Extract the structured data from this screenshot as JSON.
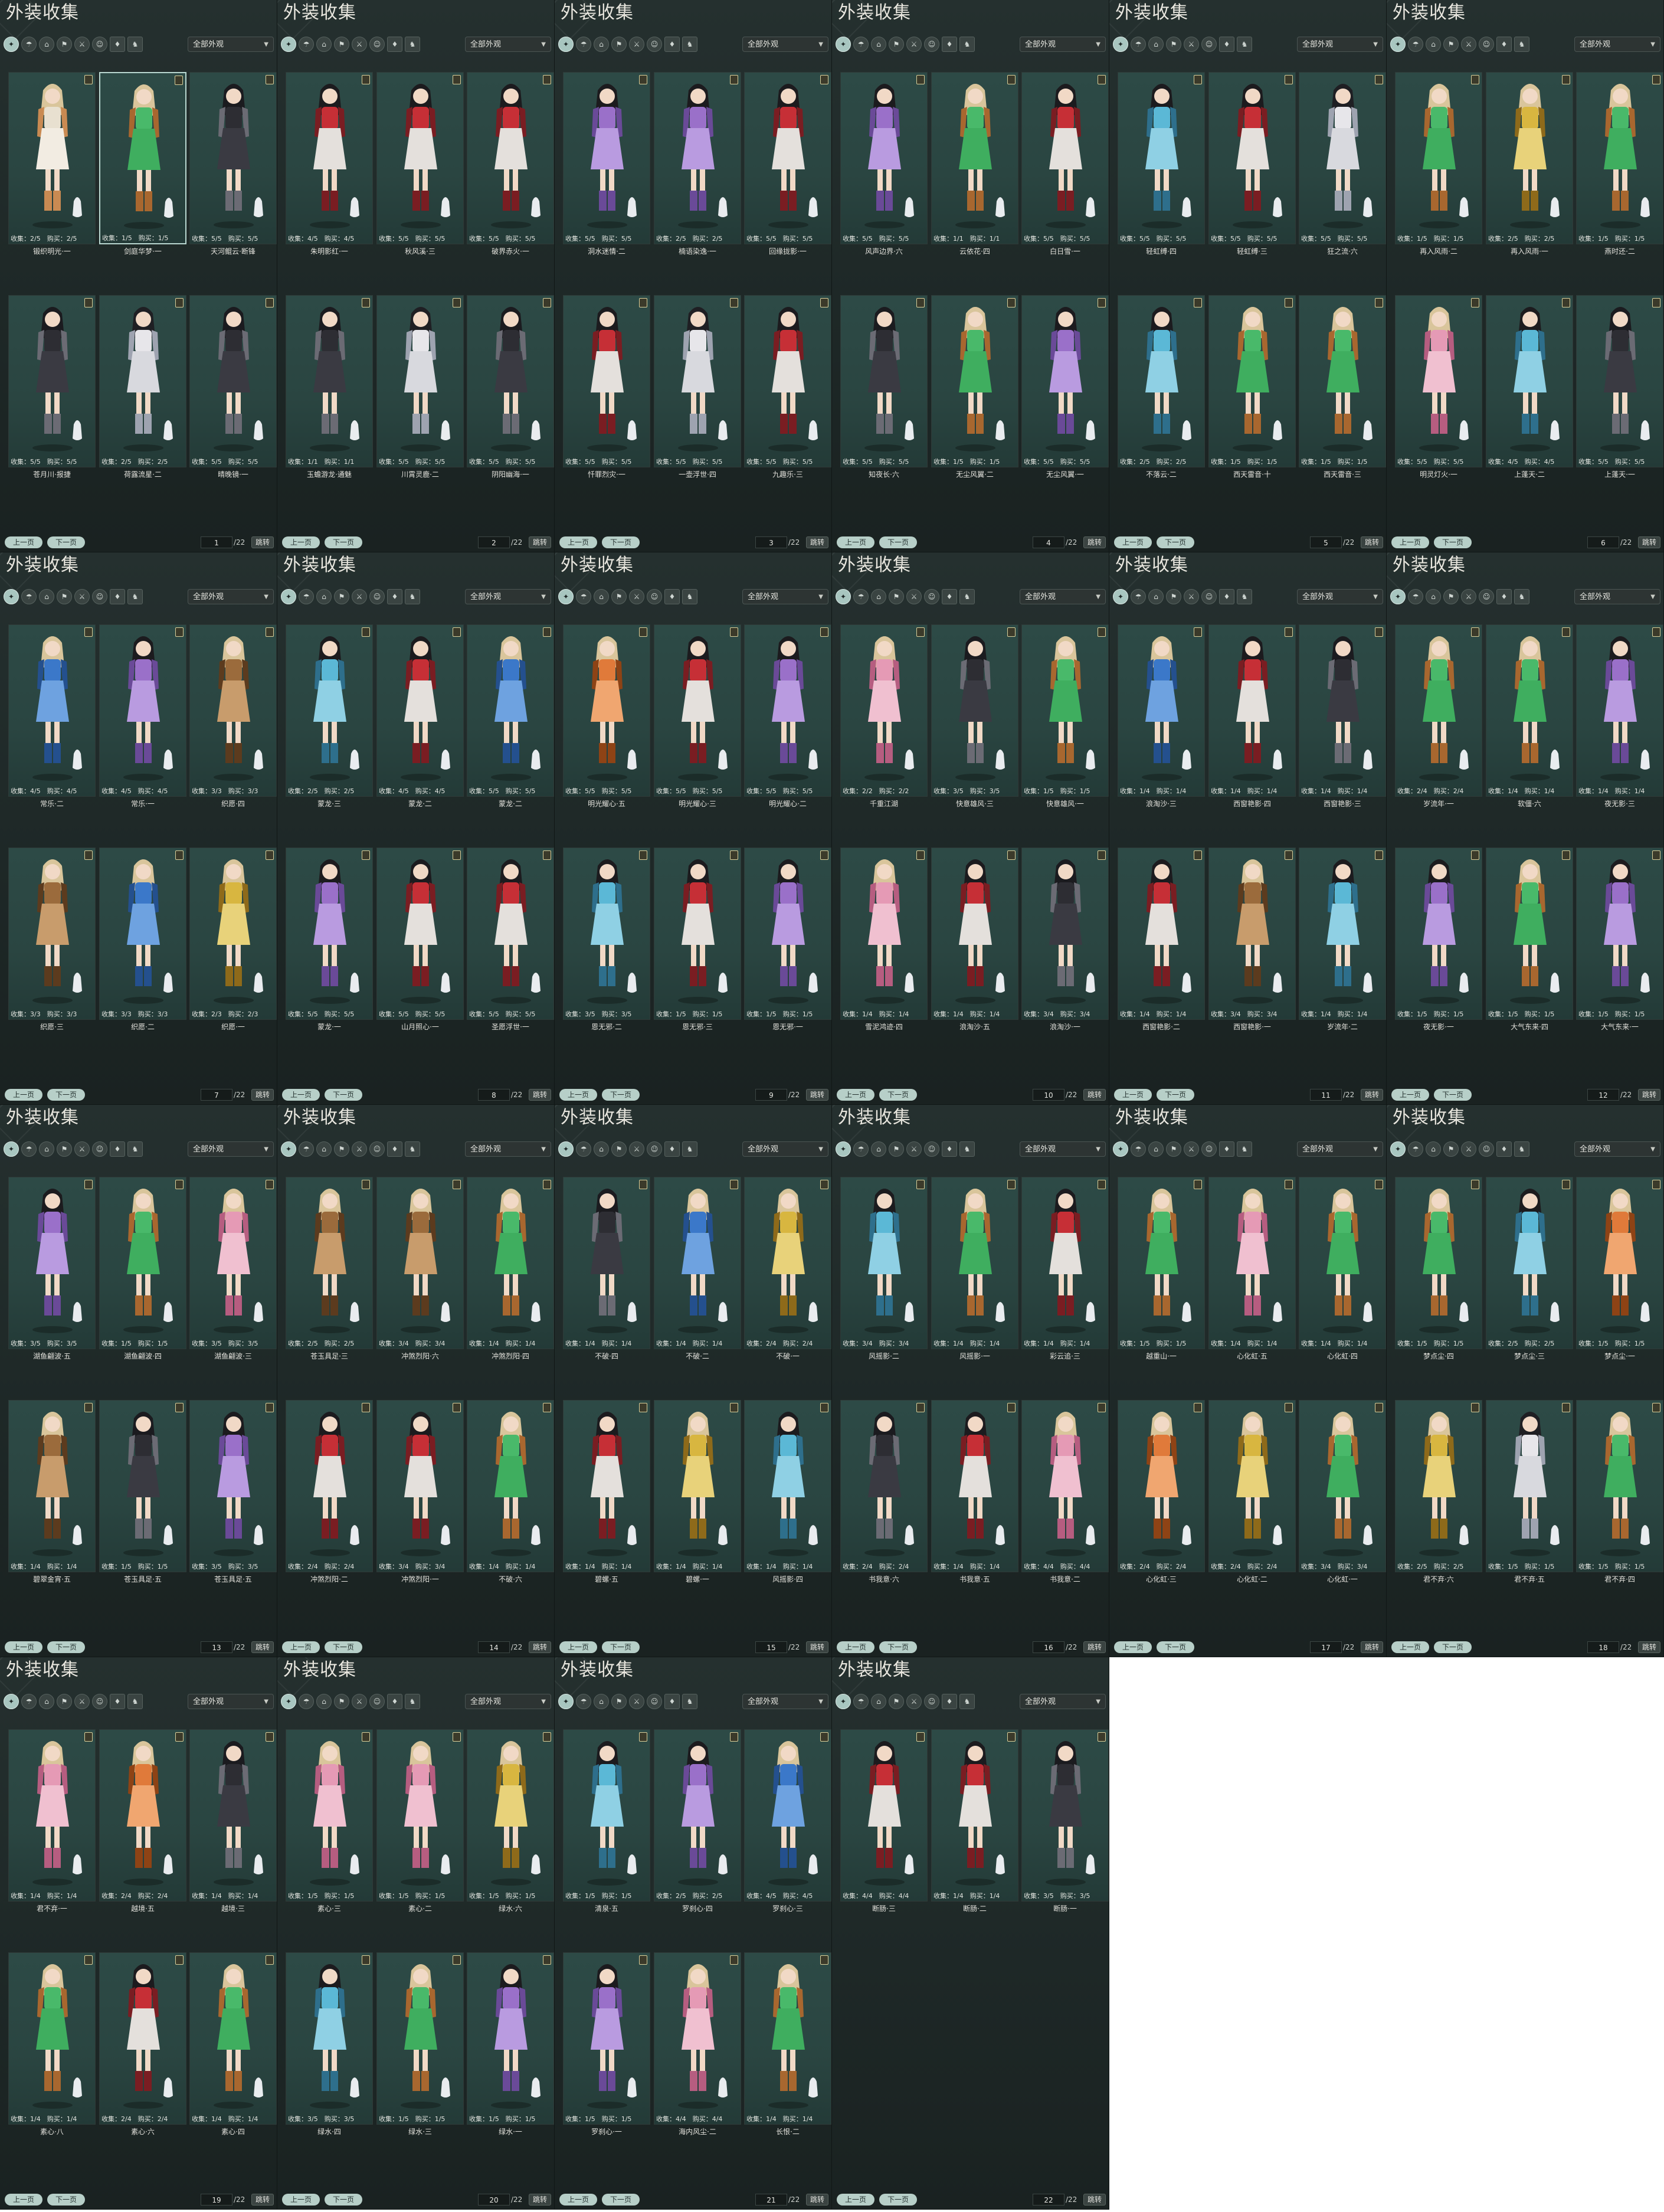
{
  "common": {
    "panel_title": "外装收集",
    "filter_value": "全部外观",
    "prev_label": "上一页",
    "next_label": "下一页",
    "jump_label": "跳转",
    "total_label": "/22",
    "tab_icons": [
      "outfit-tab",
      "hair-tab",
      "hat-tab",
      "back-tab",
      "weapon-tab",
      "face-tab",
      "pendant-tab",
      "mount-tab"
    ]
  },
  "colors": {
    "panel_bg": "#1e2827",
    "card_bg": "#2a4541",
    "accent_button": "#b7cfc8",
    "text": "#e3e2dc"
  },
  "pages": [
    {
      "page": "1",
      "items": [
        {
          "name": "锻织明光·一",
          "collect": "2/5",
          "buy": "2/5",
          "style": "a"
        },
        {
          "name": "剑庭华梦·一",
          "collect": "1/5",
          "buy": "1/5",
          "style": "b",
          "selected": true
        },
        {
          "name": "天河鲲云·断锋",
          "collect": "5/5",
          "buy": "5/5",
          "style": "k"
        },
        {
          "name": "苍月川·报捷",
          "collect": "5/5",
          "buy": "5/5",
          "style": "k"
        },
        {
          "name": "荷露流星·二",
          "collect": "2/5",
          "buy": "2/5",
          "style": "w"
        },
        {
          "name": "晴晚镜·一",
          "collect": "5/5",
          "buy": "5/5",
          "style": "k"
        }
      ]
    },
    {
      "page": "2",
      "items": [
        {
          "name": "朱明影红·一",
          "collect": "4/5",
          "buy": "4/5",
          "style": "r"
        },
        {
          "name": "秋风溪·三",
          "collect": "5/5",
          "buy": "5/5",
          "style": "r"
        },
        {
          "name": "破界赤火·一",
          "collect": "5/5",
          "buy": "5/5",
          "style": "r"
        },
        {
          "name": "玉蟾游龙·通魅",
          "collect": "1/1",
          "buy": "1/1",
          "style": "k"
        },
        {
          "name": "川霄灵鹿·二",
          "collect": "5/5",
          "buy": "5/5",
          "style": "w"
        },
        {
          "name": "阴阳幽海·一",
          "collect": "5/5",
          "buy": "5/5",
          "style": "k"
        }
      ]
    },
    {
      "page": "3",
      "items": [
        {
          "name": "洞水迷情·二",
          "collect": "5/5",
          "buy": "5/5",
          "style": "p"
        },
        {
          "name": "楠语染逸·一",
          "collect": "2/5",
          "buy": "2/5",
          "style": "p"
        },
        {
          "name": "回缘拢影·一",
          "collect": "5/5",
          "buy": "5/5",
          "style": "r"
        },
        {
          "name": "忏罪烈灾·一",
          "collect": "5/5",
          "buy": "5/5",
          "style": "r"
        },
        {
          "name": "一壶浮世·四",
          "collect": "5/5",
          "buy": "5/5",
          "style": "w"
        },
        {
          "name": "九趣乐·三",
          "collect": "5/5",
          "buy": "5/5",
          "style": "r"
        }
      ]
    },
    {
      "page": "4",
      "items": [
        {
          "name": "风声边界·六",
          "collect": "5/5",
          "buy": "5/5",
          "style": "p"
        },
        {
          "name": "云依花·四",
          "collect": "1/1",
          "buy": "1/1",
          "style": "g"
        },
        {
          "name": "白日雪·一",
          "collect": "5/5",
          "buy": "5/5",
          "style": "r"
        },
        {
          "name": "知夜长·六",
          "collect": "5/5",
          "buy": "5/5",
          "style": "k"
        },
        {
          "name": "无尘风翼·二",
          "collect": "1/5",
          "buy": "1/5",
          "style": "g"
        },
        {
          "name": "无尘风翼·一",
          "collect": "5/5",
          "buy": "5/5",
          "style": "p"
        }
      ]
    },
    {
      "page": "5",
      "items": [
        {
          "name": "轻虹缚·四",
          "collect": "5/5",
          "buy": "5/5",
          "style": "c"
        },
        {
          "name": "轻虹缚·三",
          "collect": "5/5",
          "buy": "5/5",
          "style": "r"
        },
        {
          "name": "狂之流·六",
          "collect": "5/5",
          "buy": "5/5",
          "style": "w"
        },
        {
          "name": "不落云·二",
          "collect": "2/5",
          "buy": "2/5",
          "style": "c"
        },
        {
          "name": "西天雷音·十",
          "collect": "1/5",
          "buy": "1/5",
          "style": "g"
        },
        {
          "name": "西天雷音·三",
          "collect": "1/5",
          "buy": "1/5",
          "style": "g"
        }
      ]
    },
    {
      "page": "6",
      "items": [
        {
          "name": "再入风雨·二",
          "collect": "1/5",
          "buy": "1/5",
          "style": "g"
        },
        {
          "name": "再入风雨·一",
          "collect": "2/5",
          "buy": "2/5",
          "style": "y"
        },
        {
          "name": "燕时还·二",
          "collect": "1/5",
          "buy": "1/5",
          "style": "g"
        },
        {
          "name": "明灵灯火·一",
          "collect": "5/5",
          "buy": "5/5",
          "style": "pk"
        },
        {
          "name": "上蓬天·二",
          "collect": "4/5",
          "buy": "4/5",
          "style": "c"
        },
        {
          "name": "上蓬天·一",
          "collect": "5/5",
          "buy": "5/5",
          "style": "k"
        }
      ]
    },
    {
      "page": "7",
      "items": [
        {
          "name": "常乐·二",
          "collect": "4/5",
          "buy": "4/5",
          "style": "bl"
        },
        {
          "name": "常乐·一",
          "collect": "4/5",
          "buy": "4/5",
          "style": "p"
        },
        {
          "name": "织愿·四",
          "collect": "3/3",
          "buy": "3/3",
          "style": "br"
        },
        {
          "name": "织愿·三",
          "collect": "3/3",
          "buy": "3/3",
          "style": "br"
        },
        {
          "name": "织愿·二",
          "collect": "3/3",
          "buy": "3/3",
          "style": "bl"
        },
        {
          "name": "织愿·一",
          "collect": "2/3",
          "buy": "2/3",
          "style": "y"
        }
      ]
    },
    {
      "page": "8",
      "items": [
        {
          "name": "蒙龙·三",
          "collect": "2/5",
          "buy": "2/5",
          "style": "c"
        },
        {
          "name": "蒙龙·二",
          "collect": "4/5",
          "buy": "4/5",
          "style": "r"
        },
        {
          "name": "蒙龙·二",
          "collect": "5/5",
          "buy": "5/5",
          "style": "bl"
        },
        {
          "name": "蒙龙·一",
          "collect": "5/5",
          "buy": "5/5",
          "style": "p"
        },
        {
          "name": "山月照心·一",
          "collect": "5/5",
          "buy": "5/5",
          "style": "r"
        },
        {
          "name": "圣愿浮世·一",
          "collect": "5/5",
          "buy": "5/5",
          "style": "r"
        }
      ]
    },
    {
      "page": "9",
      "items": [
        {
          "name": "明光耀心·五",
          "collect": "5/5",
          "buy": "5/5",
          "style": "o"
        },
        {
          "name": "明光耀心·三",
          "collect": "5/5",
          "buy": "5/5",
          "style": "r"
        },
        {
          "name": "明光耀心·二",
          "collect": "5/5",
          "buy": "5/5",
          "style": "p"
        },
        {
          "name": "恩无邪·二",
          "collect": "3/5",
          "buy": "3/5",
          "style": "c"
        },
        {
          "name": "恩无邪·三",
          "collect": "1/5",
          "buy": "1/5",
          "style": "r"
        },
        {
          "name": "恩无邪·一",
          "collect": "1/5",
          "buy": "1/5",
          "style": "p"
        }
      ]
    },
    {
      "page": "10",
      "items": [
        {
          "name": "千重江湖",
          "collect": "2/2",
          "buy": "2/2",
          "style": "pk"
        },
        {
          "name": "快意雄风·三",
          "collect": "3/5",
          "buy": "3/5",
          "style": "k"
        },
        {
          "name": "快意雄风·一",
          "collect": "1/5",
          "buy": "1/5",
          "style": "g"
        },
        {
          "name": "雪泥鸿迹·四",
          "collect": "1/4",
          "buy": "1/4",
          "style": "pk"
        },
        {
          "name": "浪淘沙·五",
          "collect": "1/4",
          "buy": "1/4",
          "style": "r"
        },
        {
          "name": "浪淘沙·一",
          "collect": "3/4",
          "buy": "3/4",
          "style": "k"
        }
      ]
    },
    {
      "page": "11",
      "items": [
        {
          "name": "浪淘沙·三",
          "collect": "1/4",
          "buy": "1/4",
          "style": "bl"
        },
        {
          "name": "西窗艳影·四",
          "collect": "1/4",
          "buy": "1/4",
          "style": "r"
        },
        {
          "name": "西窗艳影·三",
          "collect": "1/4",
          "buy": "1/4",
          "style": "k"
        },
        {
          "name": "西窗艳影·二",
          "collect": "1/4",
          "buy": "1/4",
          "style": "r"
        },
        {
          "name": "西窗艳影·一",
          "collect": "3/4",
          "buy": "3/4",
          "style": "br"
        },
        {
          "name": "岁流年·二",
          "collect": "1/4",
          "buy": "1/4",
          "style": "c"
        }
      ]
    },
    {
      "page": "12",
      "items": [
        {
          "name": "岁流年·一",
          "collect": "2/4",
          "buy": "2/4",
          "style": "g"
        },
        {
          "name": "软僵·六",
          "collect": "1/4",
          "buy": "1/4",
          "style": "g"
        },
        {
          "name": "夜无影·三",
          "collect": "1/4",
          "buy": "1/4",
          "style": "p"
        },
        {
          "name": "夜无影·一",
          "collect": "1/5",
          "buy": "1/5",
          "style": "p"
        },
        {
          "name": "大气东来·四",
          "collect": "1/5",
          "buy": "1/5",
          "style": "g"
        },
        {
          "name": "大气东来·一",
          "collect": "1/5",
          "buy": "1/5",
          "style": "p"
        }
      ]
    },
    {
      "page": "13",
      "items": [
        {
          "name": "湖鱼翩波·五",
          "collect": "3/5",
          "buy": "3/5",
          "style": "p"
        },
        {
          "name": "湖鱼翩波·四",
          "collect": "1/5",
          "buy": "1/5",
          "style": "g"
        },
        {
          "name": "湖鱼翩波·三",
          "collect": "3/5",
          "buy": "3/5",
          "style": "pk"
        },
        {
          "name": "碧翠金宵·五",
          "collect": "1/4",
          "buy": "1/4",
          "style": "br"
        },
        {
          "name": "苍玉具足·五",
          "collect": "1/5",
          "buy": "1/5",
          "style": "k"
        },
        {
          "name": "苍玉具足·五",
          "collect": "3/5",
          "buy": "3/5",
          "style": "p"
        }
      ]
    },
    {
      "page": "14",
      "items": [
        {
          "name": "苍玉具足·三",
          "collect": "2/5",
          "buy": "2/5",
          "style": "br"
        },
        {
          "name": "冲煞烈阳·六",
          "collect": "3/4",
          "buy": "3/4",
          "style": "br"
        },
        {
          "name": "冲煞烈阳·四",
          "collect": "1/4",
          "buy": "1/4",
          "style": "g"
        },
        {
          "name": "冲煞烈阳·二",
          "collect": "2/4",
          "buy": "2/4",
          "style": "r"
        },
        {
          "name": "冲煞烈阳·一",
          "collect": "3/4",
          "buy": "3/4",
          "style": "r"
        },
        {
          "name": "不破·六",
          "collect": "1/4",
          "buy": "1/4",
          "style": "g"
        }
      ]
    },
    {
      "page": "15",
      "items": [
        {
          "name": "不破·四",
          "collect": "1/4",
          "buy": "1/4",
          "style": "k"
        },
        {
          "name": "不破·二",
          "collect": "1/4",
          "buy": "1/4",
          "style": "bl"
        },
        {
          "name": "不破·一",
          "collect": "2/4",
          "buy": "2/4",
          "style": "y"
        },
        {
          "name": "碧螺·五",
          "collect": "1/4",
          "buy": "1/4",
          "style": "r"
        },
        {
          "name": "碧螺·一",
          "collect": "1/4",
          "buy": "1/4",
          "style": "y"
        },
        {
          "name": "风摇影·四",
          "collect": "1/4",
          "buy": "1/4",
          "style": "c"
        }
      ]
    },
    {
      "page": "16",
      "items": [
        {
          "name": "风摇影·二",
          "collect": "3/4",
          "buy": "3/4",
          "style": "c"
        },
        {
          "name": "风摇影·一",
          "collect": "1/4",
          "buy": "1/4",
          "style": "g"
        },
        {
          "name": "彩云追·三",
          "collect": "1/4",
          "buy": "1/4",
          "style": "r"
        },
        {
          "name": "书我意·六",
          "collect": "2/4",
          "buy": "2/4",
          "style": "k"
        },
        {
          "name": "书我意·五",
          "collect": "1/4",
          "buy": "1/4",
          "style": "r"
        },
        {
          "name": "书我意·二",
          "collect": "4/4",
          "buy": "4/4",
          "style": "pk"
        }
      ]
    },
    {
      "page": "17",
      "items": [
        {
          "name": "越重山·一",
          "collect": "1/5",
          "buy": "1/5",
          "style": "g"
        },
        {
          "name": "心化虹·五",
          "collect": "1/4",
          "buy": "1/4",
          "style": "pk"
        },
        {
          "name": "心化虹·四",
          "collect": "1/4",
          "buy": "1/4",
          "style": "g"
        },
        {
          "name": "心化虹·三",
          "collect": "2/4",
          "buy": "2/4",
          "style": "o"
        },
        {
          "name": "心化虹·二",
          "collect": "2/4",
          "buy": "2/4",
          "style": "y"
        },
        {
          "name": "心化虹·一",
          "collect": "3/4",
          "buy": "3/4",
          "style": "g"
        }
      ]
    },
    {
      "page": "18",
      "items": [
        {
          "name": "梦点尘·四",
          "collect": "1/5",
          "buy": "1/5",
          "style": "g"
        },
        {
          "name": "梦点尘·三",
          "collect": "2/5",
          "buy": "2/5",
          "style": "c"
        },
        {
          "name": "梦点尘·一",
          "collect": "1/5",
          "buy": "1/5",
          "style": "o"
        },
        {
          "name": "君不弃·六",
          "collect": "2/5",
          "buy": "2/5",
          "style": "y"
        },
        {
          "name": "君不弃·五",
          "collect": "1/5",
          "buy": "1/5",
          "style": "w"
        },
        {
          "name": "君不弃·四",
          "collect": "1/5",
          "buy": "1/5",
          "style": "g"
        }
      ]
    },
    {
      "page": "19",
      "items": [
        {
          "name": "君不弃·一",
          "collect": "1/4",
          "buy": "1/4",
          "style": "pk"
        },
        {
          "name": "越境·五",
          "collect": "2/4",
          "buy": "2/4",
          "style": "o"
        },
        {
          "name": "越境·三",
          "collect": "1/4",
          "buy": "1/4",
          "style": "k"
        },
        {
          "name": "素心·八",
          "collect": "1/4",
          "buy": "1/4",
          "style": "g"
        },
        {
          "name": "素心·六",
          "collect": "2/4",
          "buy": "2/4",
          "style": "r"
        },
        {
          "name": "素心·四",
          "collect": "1/4",
          "buy": "1/4",
          "style": "g"
        }
      ]
    },
    {
      "page": "20",
      "items": [
        {
          "name": "素心·三",
          "collect": "1/5",
          "buy": "1/5",
          "style": "pk"
        },
        {
          "name": "素心·二",
          "collect": "1/5",
          "buy": "1/5",
          "style": "pk"
        },
        {
          "name": "绿水·六",
          "collect": "1/5",
          "buy": "1/5",
          "style": "y"
        },
        {
          "name": "绿水·四",
          "collect": "3/5",
          "buy": "3/5",
          "style": "c"
        },
        {
          "name": "绿水·三",
          "collect": "1/5",
          "buy": "1/5",
          "style": "g"
        },
        {
          "name": "绿水·一",
          "collect": "1/5",
          "buy": "1/5",
          "style": "p"
        }
      ]
    },
    {
      "page": "21",
      "items": [
        {
          "name": "清泉·五",
          "collect": "1/5",
          "buy": "1/5",
          "style": "c"
        },
        {
          "name": "罗刹心·四",
          "collect": "2/5",
          "buy": "2/5",
          "style": "p"
        },
        {
          "name": "罗刹心·三",
          "collect": "4/5",
          "buy": "4/5",
          "style": "bl"
        },
        {
          "name": "罗刹心·一",
          "collect": "1/5",
          "buy": "1/5",
          "style": "p"
        },
        {
          "name": "海内风尘·二",
          "collect": "4/4",
          "buy": "4/4",
          "style": "pk"
        },
        {
          "name": "长恨·二",
          "collect": "1/4",
          "buy": "1/4",
          "style": "g"
        }
      ]
    },
    {
      "page": "22",
      "items": [
        {
          "name": "断肠·三",
          "collect": "4/4",
          "buy": "4/4",
          "style": "r"
        },
        {
          "name": "断肠·二",
          "collect": "1/4",
          "buy": "1/4",
          "style": "r"
        },
        {
          "name": "断肠·一",
          "collect": "3/5",
          "buy": "3/5",
          "style": "k"
        }
      ]
    }
  ]
}
